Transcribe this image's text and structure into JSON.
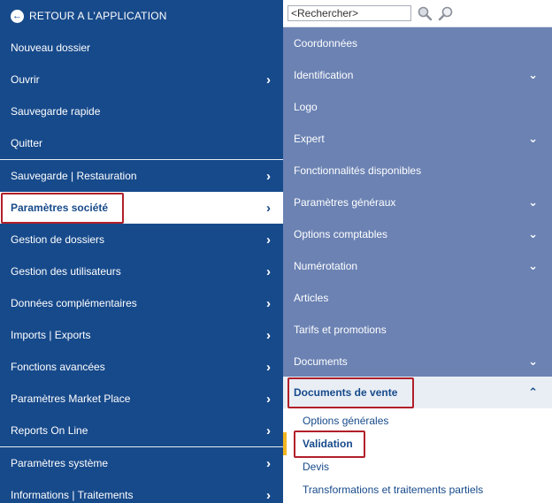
{
  "left": {
    "back_label": "RETOUR A L'APPLICATION",
    "items": [
      {
        "label": "Nouveau dossier",
        "has_arrow": false
      },
      {
        "label": "Ouvrir",
        "has_arrow": true
      },
      {
        "label": "Sauvegarde rapide",
        "has_arrow": false
      },
      {
        "label": "Quitter",
        "has_arrow": false
      },
      {
        "label": "Sauvegarde | Restauration",
        "has_arrow": true
      },
      {
        "label": "Paramètres société",
        "has_arrow": true,
        "active": true
      },
      {
        "label": "Gestion de dossiers",
        "has_arrow": true
      },
      {
        "label": "Gestion des utilisateurs",
        "has_arrow": true
      },
      {
        "label": "Données complémentaires",
        "has_arrow": true
      },
      {
        "label": "Imports | Exports",
        "has_arrow": true
      },
      {
        "label": "Fonctions avancées",
        "has_arrow": true
      },
      {
        "label": "Paramètres Market Place",
        "has_arrow": true
      },
      {
        "label": "Reports On Line",
        "has_arrow": true
      },
      {
        "label": "Paramètres système",
        "has_arrow": true
      },
      {
        "label": "Informations | Traitements",
        "has_arrow": true
      }
    ]
  },
  "right": {
    "search_placeholder": "<Rechercher>",
    "items": [
      {
        "label": "Coordonnées",
        "has_chevron": false
      },
      {
        "label": "Identification",
        "has_chevron": true
      },
      {
        "label": "Logo",
        "has_chevron": false
      },
      {
        "label": "Expert",
        "has_chevron": true
      },
      {
        "label": "Fonctionnalités disponibles",
        "has_chevron": false
      },
      {
        "label": "Paramètres généraux",
        "has_chevron": true
      },
      {
        "label": "Options comptables",
        "has_chevron": true
      },
      {
        "label": "Numérotation",
        "has_chevron": true
      },
      {
        "label": "Articles",
        "has_chevron": false
      },
      {
        "label": "Tarifs et promotions",
        "has_chevron": false
      },
      {
        "label": "Documents",
        "has_chevron": true
      }
    ],
    "expanded_section": "Documents de vente",
    "sub_items": [
      {
        "label": "Options générales"
      },
      {
        "label": "Validation",
        "selected": true
      },
      {
        "label": "Devis"
      },
      {
        "label": "Transformations et traitements partiels"
      }
    ]
  },
  "colors": {
    "left_bg": "#174a8b",
    "right_bg": "#6b82b3",
    "highlight_border": "#b11f2a",
    "selection_marker": "#f3b61f",
    "link_text": "#174a8b"
  },
  "icons": {
    "back": "arrow-left-circle-icon",
    "search": "search-icon",
    "advanced_search": "advanced-search-icon",
    "arrow": "chevron-right-icon",
    "expand": "chevron-down-icon",
    "collapse": "chevron-up-icon"
  }
}
